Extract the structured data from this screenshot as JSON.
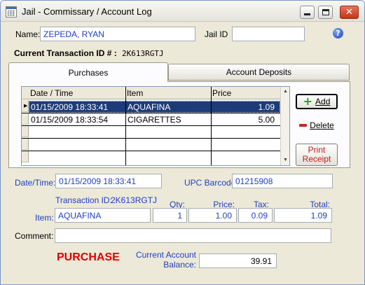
{
  "window": {
    "title": "Jail - Commissary / Account Log",
    "controls": {
      "minimize": "minimize",
      "maximize": "maximize",
      "close": "close"
    }
  },
  "header": {
    "name_label": "Name:",
    "name_value": "ZEPEDA, RYAN",
    "jail_id_label": "Jail ID",
    "jail_id_value": "",
    "help_glyph": "?",
    "current_txn_label": "Current Transaction ID # :",
    "current_txn_value": "2K613RGTJ"
  },
  "tabs": [
    {
      "label": "Purchases",
      "active": true
    },
    {
      "label": "Account Deposits",
      "active": false
    }
  ],
  "grid": {
    "columns": [
      "Date / Time",
      "Item",
      "Price"
    ],
    "rows": [
      {
        "datetime": "01/15/2009 18:33:41",
        "item": "AQUAFINA",
        "price": "1.09",
        "selected": true
      },
      {
        "datetime": "01/15/2009 18:33:54",
        "item": "CIGARETTES",
        "price": "5.00",
        "selected": false
      }
    ]
  },
  "buttons": {
    "add": "Add",
    "delete": "Delete",
    "print_line1": "Print",
    "print_line2": "Receipt"
  },
  "detail": {
    "datetime_label": "Date/Time:",
    "datetime_value": "01/15/2009 18:33:41",
    "upc_label": "UPC Barcode",
    "upc_value": "01215908",
    "transaction_id_label": "Transaction ID:",
    "transaction_id_value": "2K613RGTJ",
    "item_label": "Item:",
    "item_value": "AQUAFINA",
    "qty_label": "Qty:",
    "qty_value": "1",
    "price_label": "Price:",
    "price_value": "1.00",
    "tax_label": "Tax:",
    "tax_value": "0.09",
    "total_label": "Total:",
    "total_value": "1.09",
    "comment_label": "Comment:",
    "comment_value": "",
    "mode_text": "PURCHASE",
    "balance_label_line1": "Current Account",
    "balance_label_line2": "Balance:",
    "balance_value": "39.91"
  },
  "colors": {
    "label_blue": "#1f3fbf",
    "selected_row": "#1c3b78",
    "purchase_red": "#e00000",
    "print_red": "#c41818"
  }
}
